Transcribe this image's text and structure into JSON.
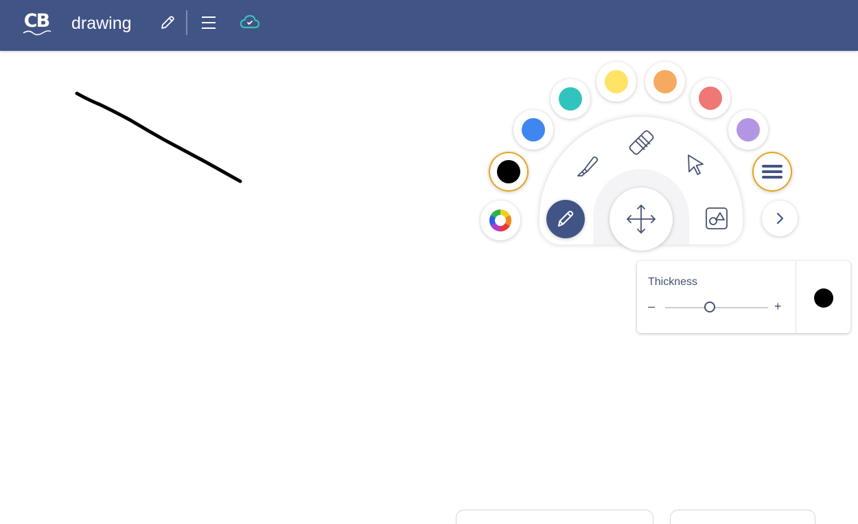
{
  "header": {
    "logo_text": "CB",
    "doc_title": "drawing",
    "sync_status": "cloud-check-icon"
  },
  "palette": {
    "selected_color": "#000000",
    "colors": [
      {
        "name": "black",
        "hex": "#000000"
      },
      {
        "name": "blue",
        "hex": "#3f86f0"
      },
      {
        "name": "teal",
        "hex": "#31c4be"
      },
      {
        "name": "yellow",
        "hex": "#fde466"
      },
      {
        "name": "orange",
        "hex": "#f6a961"
      },
      {
        "name": "red",
        "hex": "#ef7774"
      },
      {
        "name": "purple",
        "hex": "#b396e3"
      }
    ]
  },
  "tools": {
    "active": "pen",
    "items": [
      "pen-icon",
      "highlighter-icon",
      "eraser-icon",
      "select-pointer-icon",
      "move-icon",
      "shapes-icon"
    ]
  },
  "thickness": {
    "label": "Thickness",
    "minus": "–",
    "plus": "+",
    "value_fraction": 0.43
  },
  "colors": {
    "header_bg": "#415486",
    "accent_ring": "#e8a31c",
    "icon_color": "#44506e"
  }
}
